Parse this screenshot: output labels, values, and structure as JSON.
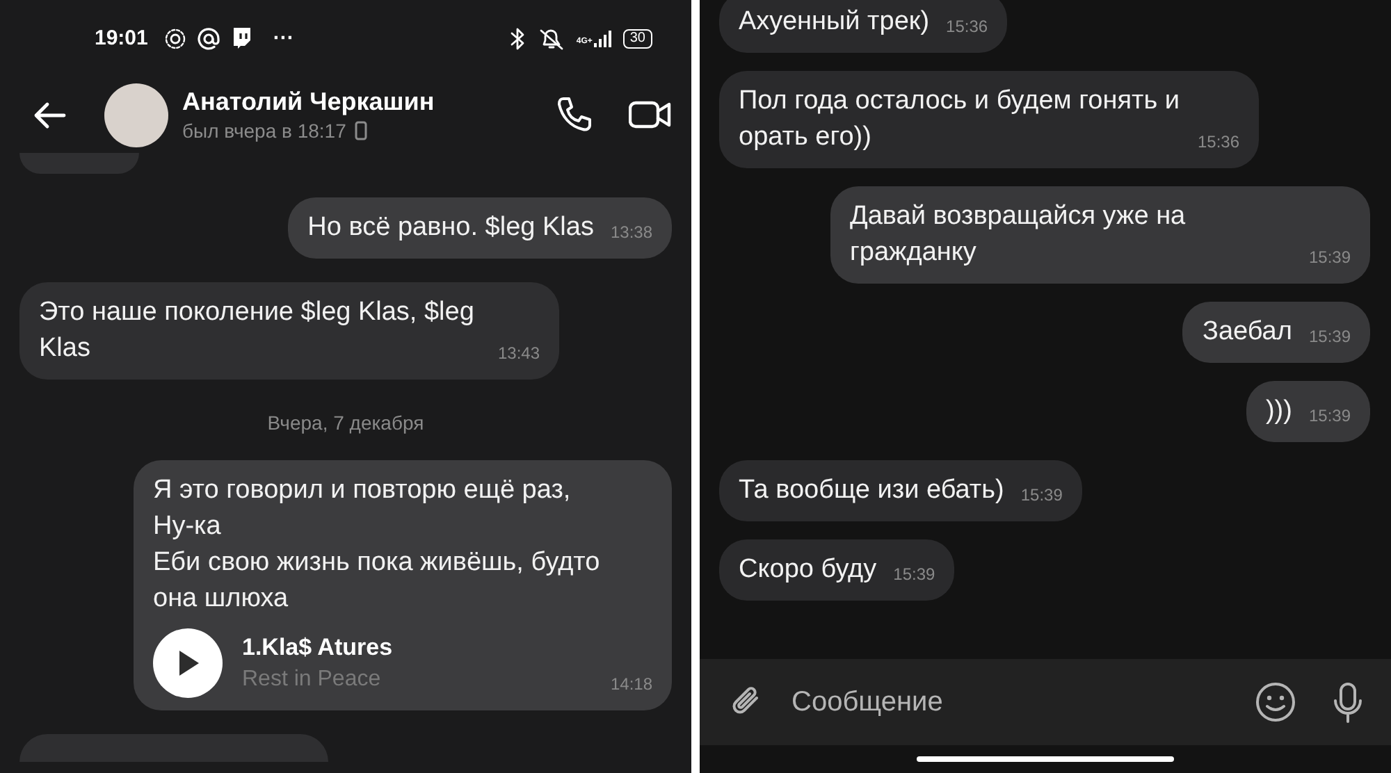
{
  "left_screen": {
    "status_bar": {
      "time": "19:01",
      "more": "···",
      "network": "4G+",
      "battery": "30"
    },
    "header": {
      "name": "Анатолий Черкашин",
      "last_seen": "был вчера в 18:17"
    },
    "messages": [
      {
        "kind": "partial",
        "outgoing": false
      },
      {
        "kind": "text",
        "outgoing": true,
        "text": "Но всё равно. $leg Klas",
        "time": "13:38"
      },
      {
        "kind": "text",
        "outgoing": false,
        "text": "Это наше поколение $leg Klas, $leg Klas",
        "time": "13:43"
      },
      {
        "kind": "date",
        "text": "Вчера, 7 декабря"
      },
      {
        "kind": "audio",
        "outgoing": true,
        "text": "Я это говорил и повторю ещё раз,\nНу-ка\nЕби свою жизнь пока живёшь, будто\nона шлюха",
        "track": "1.Kla$ Atures",
        "artist": "Rest in Peace",
        "time": "14:18"
      },
      {
        "kind": "partial",
        "outgoing": false
      }
    ]
  },
  "right_screen": {
    "messages": [
      {
        "kind": "text",
        "outgoing": false,
        "text": "Ахуенный трек)",
        "time": "15:36"
      },
      {
        "kind": "text",
        "outgoing": false,
        "text": "Пол года осталось и будем гонять и орать его))",
        "time": "15:36"
      },
      {
        "kind": "text",
        "outgoing": true,
        "text": "Давай возвращайся уже на гражданку",
        "time": "15:39"
      },
      {
        "kind": "text",
        "outgoing": true,
        "text": "Заебал",
        "time": "15:39"
      },
      {
        "kind": "text",
        "outgoing": true,
        "text": ")))",
        "time": "15:39"
      },
      {
        "kind": "text",
        "outgoing": false,
        "text": "Та вообще изи ебать)",
        "time": "15:39"
      },
      {
        "kind": "text",
        "outgoing": false,
        "text": "Скоро буду",
        "time": "15:39"
      }
    ],
    "composer": {
      "placeholder": "Сообщение"
    }
  }
}
